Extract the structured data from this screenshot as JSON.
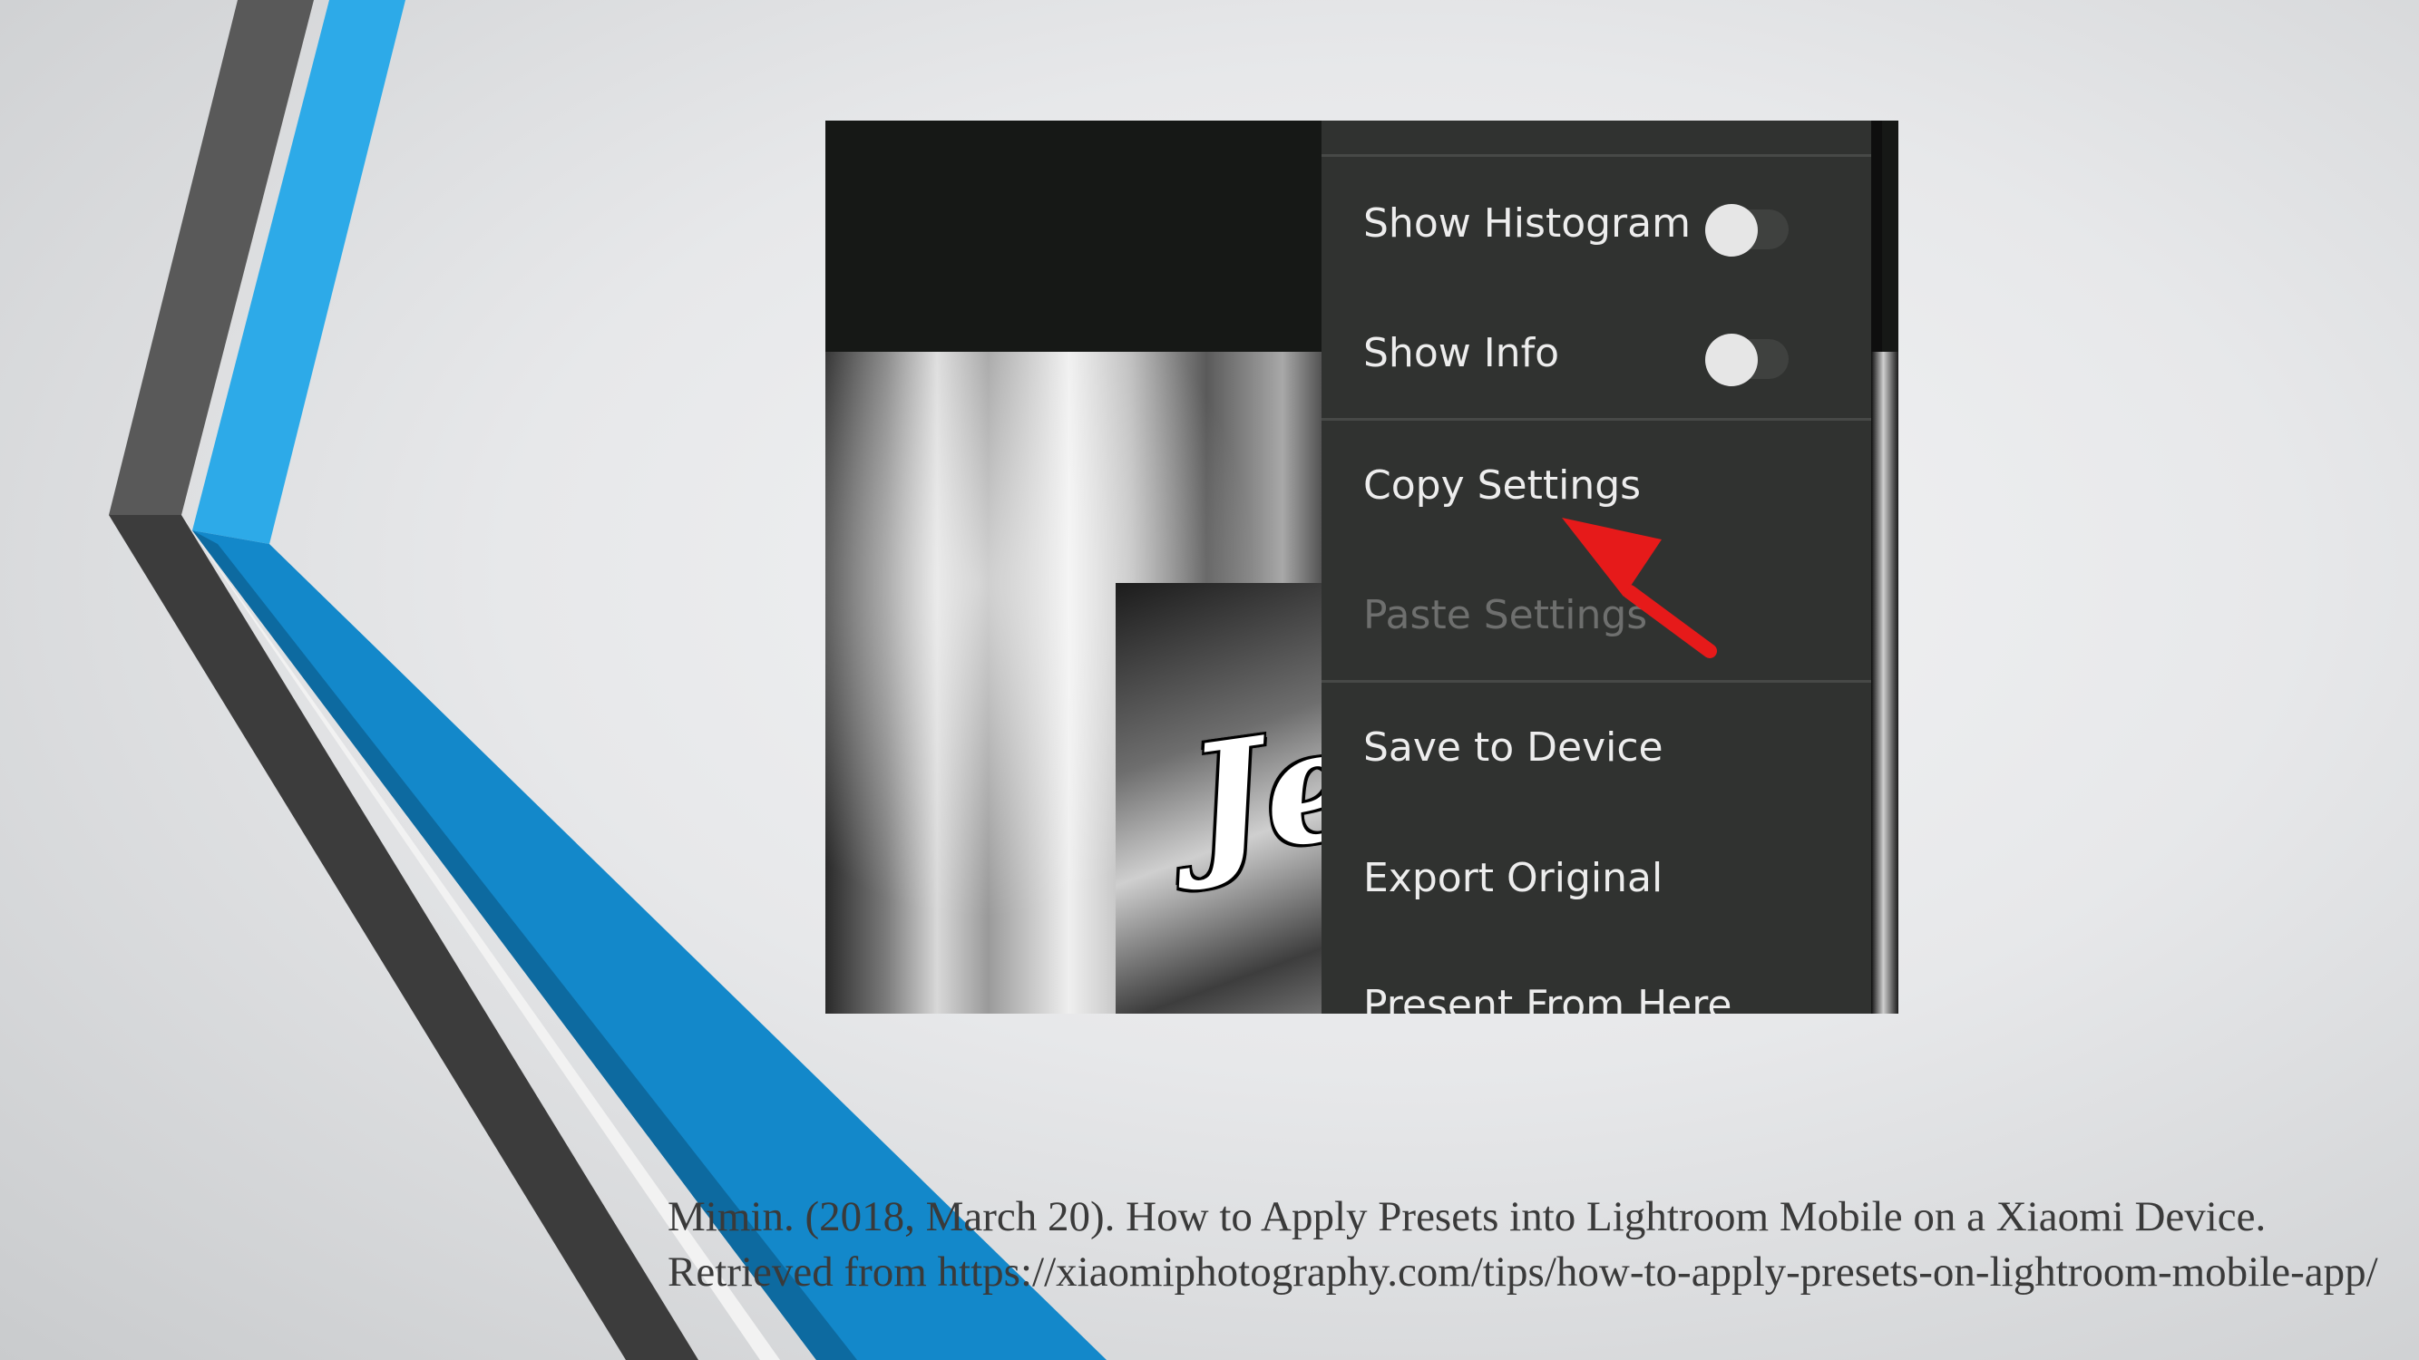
{
  "colors": {
    "accent_blue": "#29a8e6",
    "accent_blue_dark": "#1185c8",
    "stripe_gray": "#595959",
    "stripe_dark": "#3d3d3d",
    "menu_bg": "#303230",
    "menu_text": "#ededed",
    "menu_disabled": "#6e6f6e",
    "arrow_red": "#e61a1a"
  },
  "screenshot": {
    "photo_text": "Jen",
    "menu": {
      "items": [
        {
          "label": "Show Histogram",
          "type": "toggle",
          "on": false
        },
        {
          "label": "Show Info",
          "type": "toggle",
          "on": false
        },
        {
          "label": "Copy Settings",
          "type": "action"
        },
        {
          "label": "Paste Settings",
          "type": "action",
          "disabled": true
        },
        {
          "label": "Save to Device",
          "type": "action"
        },
        {
          "label": "Export Original",
          "type": "action"
        },
        {
          "label": "Present From Here",
          "type": "action"
        }
      ],
      "pointer": {
        "icon": "arrow-icon",
        "points_to": "Copy Settings"
      }
    }
  },
  "caption": {
    "text": "Mimin. (2018, March 20). How to Apply Presets into Lightroom Mobile on a Xiaomi Device. Retrieved from https://xiaomiphotography.com/tips/how-to-apply-presets-on-lightroom-mobile-app/"
  }
}
